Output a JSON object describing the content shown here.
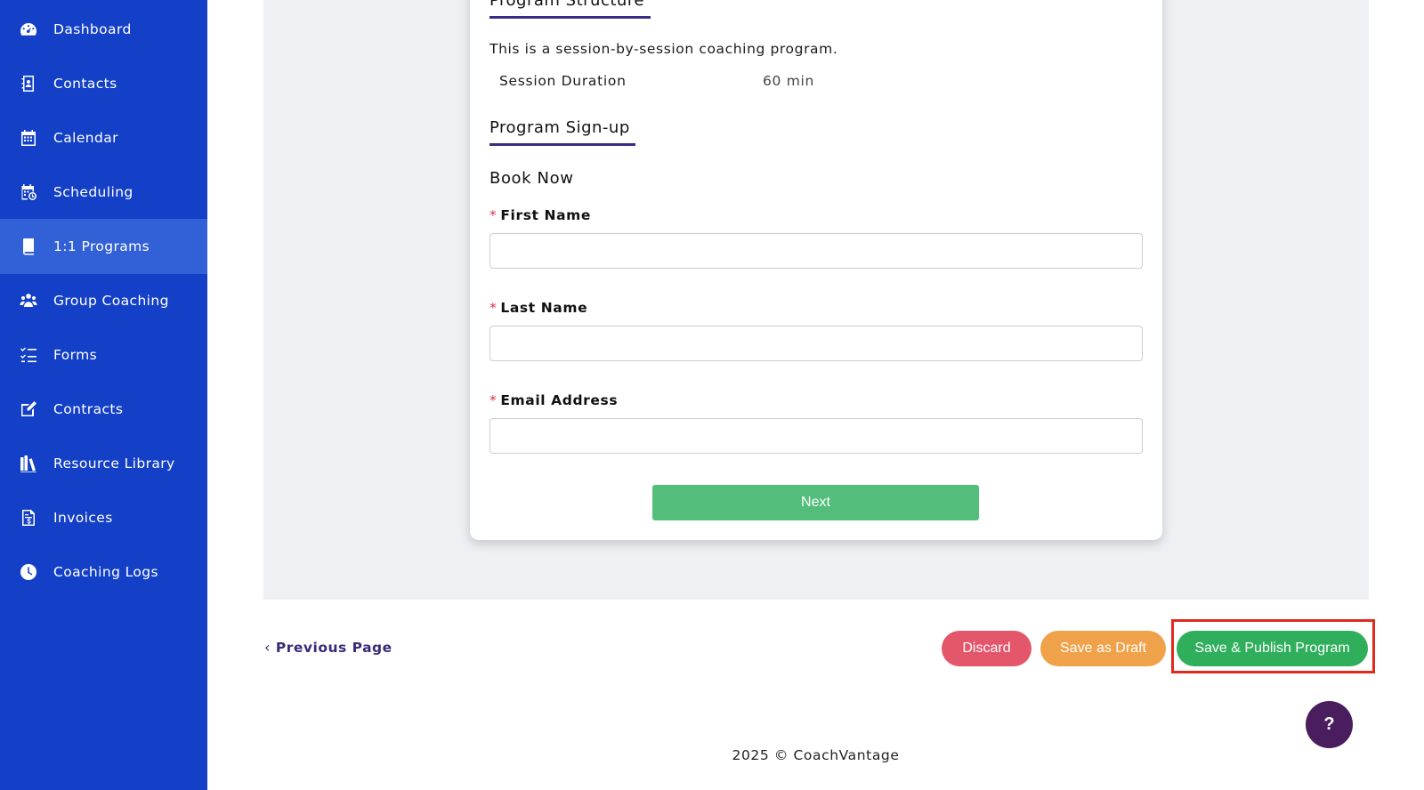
{
  "sidebar": {
    "items": [
      {
        "label": "Dashboard",
        "icon": "dashboard-icon"
      },
      {
        "label": "Contacts",
        "icon": "contacts-icon"
      },
      {
        "label": "Calendar",
        "icon": "calendar-icon"
      },
      {
        "label": "Scheduling",
        "icon": "scheduling-icon"
      },
      {
        "label": "1:1 Programs",
        "icon": "book-icon",
        "active": true
      },
      {
        "label": "Group Coaching",
        "icon": "group-icon"
      },
      {
        "label": "Forms",
        "icon": "checklist-icon"
      },
      {
        "label": "Contracts",
        "icon": "edit-icon"
      },
      {
        "label": "Resource Library",
        "icon": "library-icon"
      },
      {
        "label": "Invoices",
        "icon": "invoice-icon"
      },
      {
        "label": "Coaching Logs",
        "icon": "clock-icon"
      }
    ]
  },
  "card": {
    "structure_title": "Program Structure",
    "description": "This is a session-by-session coaching program.",
    "duration_label": "Session Duration",
    "duration_value": "60 min",
    "signup_title": "Program Sign-up",
    "book_now": "Book Now",
    "fields": [
      {
        "required_mark": "*",
        "label": "First Name",
        "value": ""
      },
      {
        "required_mark": "*",
        "label": "Last Name",
        "value": ""
      },
      {
        "required_mark": "*",
        "label": "Email Address",
        "value": ""
      }
    ],
    "next_label": "Next"
  },
  "footer": {
    "prev_chevron": "‹",
    "prev_label": "Previous Page",
    "discard_label": "Discard",
    "draft_label": "Save as Draft",
    "publish_label": "Save & Publish Program",
    "help_label": "?",
    "copyright": "2025 © CoachVantage"
  },
  "colors": {
    "sidebar": "#1440c7",
    "sidebar_active": "#3260d6",
    "accent_underline": "#3c2a86",
    "next": "#53bd7c",
    "discard": "#e4566a",
    "draft": "#f0a24a",
    "publish": "#2fae5c",
    "highlight": "#e02a1e",
    "help": "#4a1d5e"
  }
}
